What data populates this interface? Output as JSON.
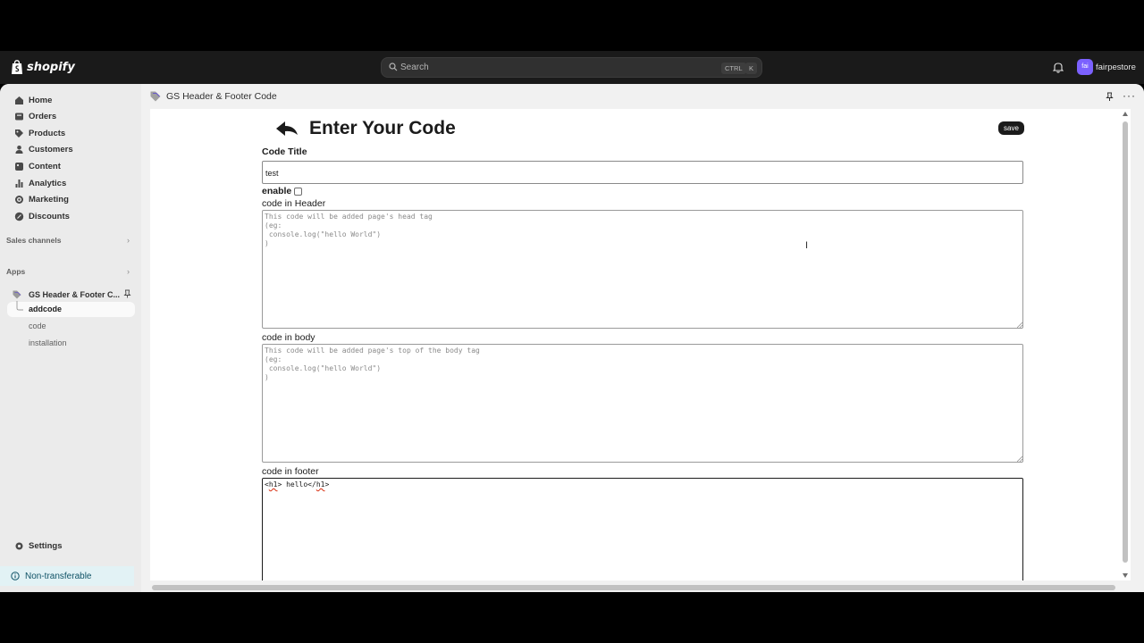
{
  "topbar": {
    "logo_text": "shopify",
    "search_placeholder": "Search",
    "shortcut_ctrl": "CTRL",
    "shortcut_k": "K",
    "avatar_initials": "fai",
    "store_name": "fairpestore"
  },
  "sidebar": {
    "items": [
      {
        "label": "Home",
        "icon": "home-icon"
      },
      {
        "label": "Orders",
        "icon": "orders-icon"
      },
      {
        "label": "Products",
        "icon": "tag-icon"
      },
      {
        "label": "Customers",
        "icon": "person-icon"
      },
      {
        "label": "Content",
        "icon": "content-icon"
      },
      {
        "label": "Analytics",
        "icon": "bar-chart-icon"
      },
      {
        "label": "Marketing",
        "icon": "target-icon"
      },
      {
        "label": "Discounts",
        "icon": "discount-icon"
      }
    ],
    "sales_channels_label": "Sales channels",
    "apps_label": "Apps",
    "app_name": "GS Header & Footer C...",
    "app_subitems": [
      "addcode",
      "code",
      "installation"
    ],
    "settings_label": "Settings",
    "non_transferable_label": "Non-transferable"
  },
  "header": {
    "app_title": "GS Header & Footer Code"
  },
  "form": {
    "heading": "Enter Your Code",
    "save_label": "save",
    "code_title_label": "Code Title",
    "code_title_value": "test",
    "enable_label": "enable",
    "enable_checked": false,
    "header_label": "code in Header",
    "header_placeholder": "This code will be added page's head tag\n(eg:\n console.log(\"hello World\")\n)",
    "body_label": "code in body",
    "body_placeholder": "This code will be added page's top of the body tag\n(eg:\n console.log(\"hello World\")\n)",
    "footer_label": "code in footer",
    "footer_value_parts": [
      "<",
      "h1",
      "> hello</",
      "h1",
      ">"
    ]
  },
  "colors": {
    "topbar_bg": "#1a1a1a",
    "avatar_bg": "#7b61ff",
    "save_bg": "#1b1b1b",
    "non_transferable_bg": "#e2f2f5"
  }
}
